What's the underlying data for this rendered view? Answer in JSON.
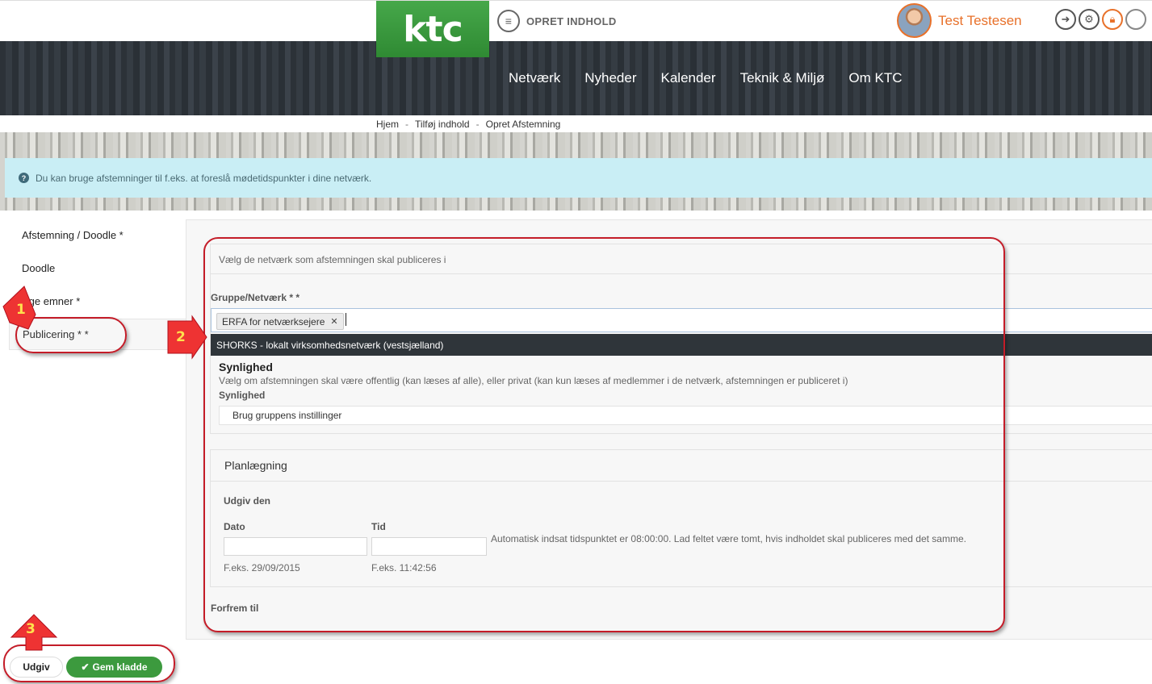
{
  "header": {
    "logo_text": "ktc",
    "create_label": "OPRET INDHOLD",
    "user_name": "Test Testesen",
    "tool_icons": [
      "download-icon",
      "gear-icon",
      "lock-icon",
      "settings-icon"
    ],
    "accent_color": "#e8712a",
    "brand_color": "#3a9a3e"
  },
  "nav": {
    "items": [
      "Netværk",
      "Nyheder",
      "Kalender",
      "Teknik & Miljø",
      "Om KTC"
    ]
  },
  "breadcrumb": {
    "items": [
      "Hjem",
      "Tilføj indhold",
      "Opret Afstemning"
    ],
    "separator": "-"
  },
  "info": {
    "text": "Du kan bruge afstemninger til f.eks. at foreslå mødetidspunkter i dine netværk."
  },
  "sidebar": {
    "tabs": [
      {
        "label": "Afstemning / Doodle *"
      },
      {
        "label": "Doodle"
      },
      {
        "label": "ilige emner *"
      },
      {
        "label": "Publicering * *"
      }
    ]
  },
  "publishing": {
    "intro": "Vælg de netværk som afstemningen skal publiceres i",
    "group_label": "Gruppe/Netværk * *",
    "selected_chip": "ERFA for netværksejere",
    "chip_remove": "✕",
    "dropdown_option": "SHORKS - lokalt virksomhedsnetværk (vestsjælland)",
    "visibility_heading": "Synlighed",
    "visibility_desc": "Vælg om afstemningen skal være offentlig (kan læses af alle), eller privat (kan kun læses af medlemmer i de netværk, afstemningen er publiceret i)",
    "visibility_label": "Synlighed",
    "visibility_value": "Brug gruppens instillinger"
  },
  "planning": {
    "heading": "Planlægning",
    "publish_on_label": "Udgiv den",
    "date_label": "Dato",
    "date_value": "",
    "date_hint": "F.eks. 29/09/2015",
    "time_label": "Tid",
    "time_value": "",
    "time_hint": "F.eks. 11:42:56",
    "auto_note": "Automatisk indsat tidspunktet er 08:00:00. Lad feltet være tomt, hvis indholdet skal publiceres med det samme.",
    "promote_label": "Forfrem til"
  },
  "actions": {
    "publish_label": "Udgiv",
    "save_draft_label": "Gem kladde",
    "save_draft_icon": "✔"
  },
  "annotations": {
    "markers": [
      "1",
      "2",
      "3"
    ],
    "color": "#c41c28"
  }
}
